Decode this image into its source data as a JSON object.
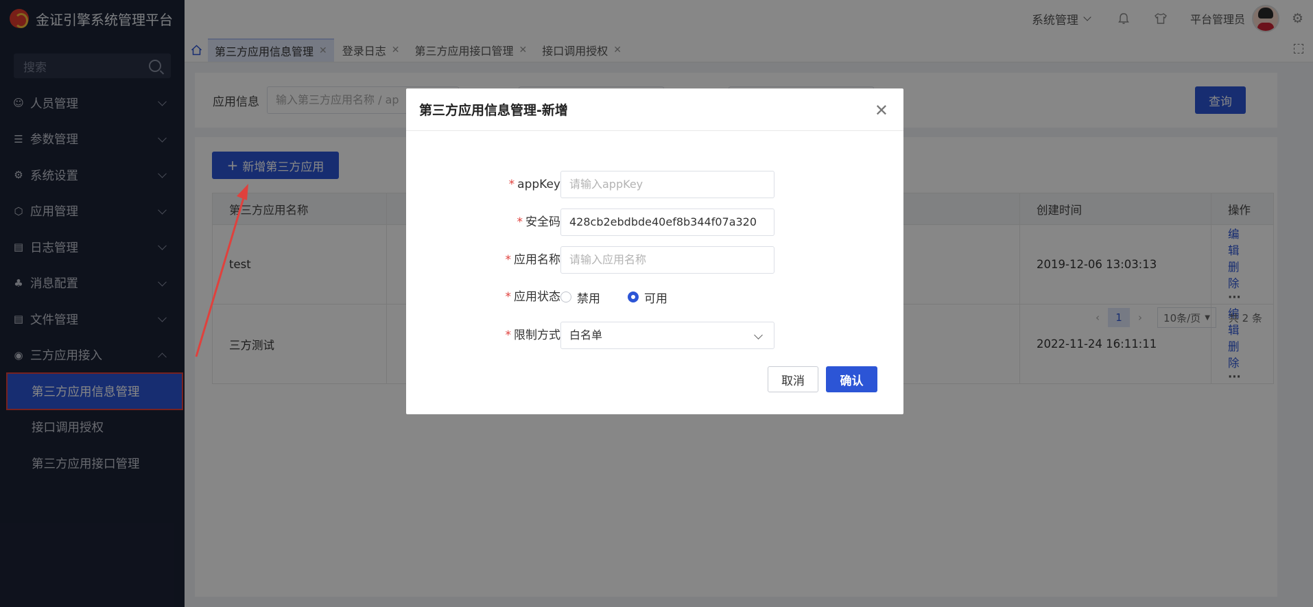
{
  "app": {
    "title": "金证引擎系统管理平台"
  },
  "sidebar": {
    "search_placeholder": "搜索",
    "menu": [
      {
        "label": "人员管理",
        "icon": "user-icon"
      },
      {
        "label": "参数管理",
        "icon": "sliders-icon"
      },
      {
        "label": "系统设置",
        "icon": "gear-icon"
      },
      {
        "label": "应用管理",
        "icon": "cube-icon"
      },
      {
        "label": "日志管理",
        "icon": "log-icon"
      },
      {
        "label": "消息配置",
        "icon": "message-icon"
      },
      {
        "label": "文件管理",
        "icon": "file-icon"
      },
      {
        "label": "三方应用接入",
        "icon": "globe-icon"
      }
    ],
    "submenu": [
      {
        "label": "第三方应用信息管理",
        "active": true
      },
      {
        "label": "接口调用授权",
        "active": false
      },
      {
        "label": "第三方应用接口管理",
        "active": false
      }
    ]
  },
  "header": {
    "system_menu": "系统管理",
    "user_name": "平台管理员"
  },
  "tabs": [
    {
      "label": "第三方应用信息管理",
      "active": true
    },
    {
      "label": "登录日志",
      "active": false
    },
    {
      "label": "第三方应用接口管理",
      "active": false
    },
    {
      "label": "接口调用授权",
      "active": false
    }
  ],
  "filter": {
    "label": "应用信息",
    "placeholder": "输入第三方应用名称 / ap",
    "query_label": "查询"
  },
  "toolbar": {
    "add_label": "新增第三方应用"
  },
  "table": {
    "columns": [
      "第三方应用名称",
      "",
      "",
      "创建时间",
      "操作"
    ],
    "rows": [
      {
        "name": "test",
        "created": "2019-12-06 13:03:13"
      },
      {
        "name": "三方测试",
        "created": "2022-11-24 16:11:11"
      }
    ],
    "actions": {
      "edit": "编辑",
      "delete": "删除",
      "more": "···"
    }
  },
  "pagination": {
    "current_page": "1",
    "page_size": "10条/页",
    "total": "共 2 条"
  },
  "dialog": {
    "title": "第三方应用信息管理-新增",
    "fields": {
      "appkey": {
        "label": "appKey",
        "placeholder": "请输入appKey",
        "value": ""
      },
      "secret": {
        "label": "安全码",
        "value": "428cb2ebdbde40ef8b344f07a320"
      },
      "app_name": {
        "label": "应用名称",
        "placeholder": "请输入应用名称",
        "value": ""
      },
      "status": {
        "label": "应用状态",
        "options": [
          "禁用",
          "可用"
        ],
        "selected": "可用"
      },
      "limit": {
        "label": "限制方式",
        "value": "白名单"
      }
    },
    "cancel_label": "取消",
    "confirm_label": "确认"
  },
  "colors": {
    "primary": "#2c55d6",
    "sidebar_bg": "#1c2236",
    "required": "#e0413d",
    "annotation": "#e0413d"
  }
}
